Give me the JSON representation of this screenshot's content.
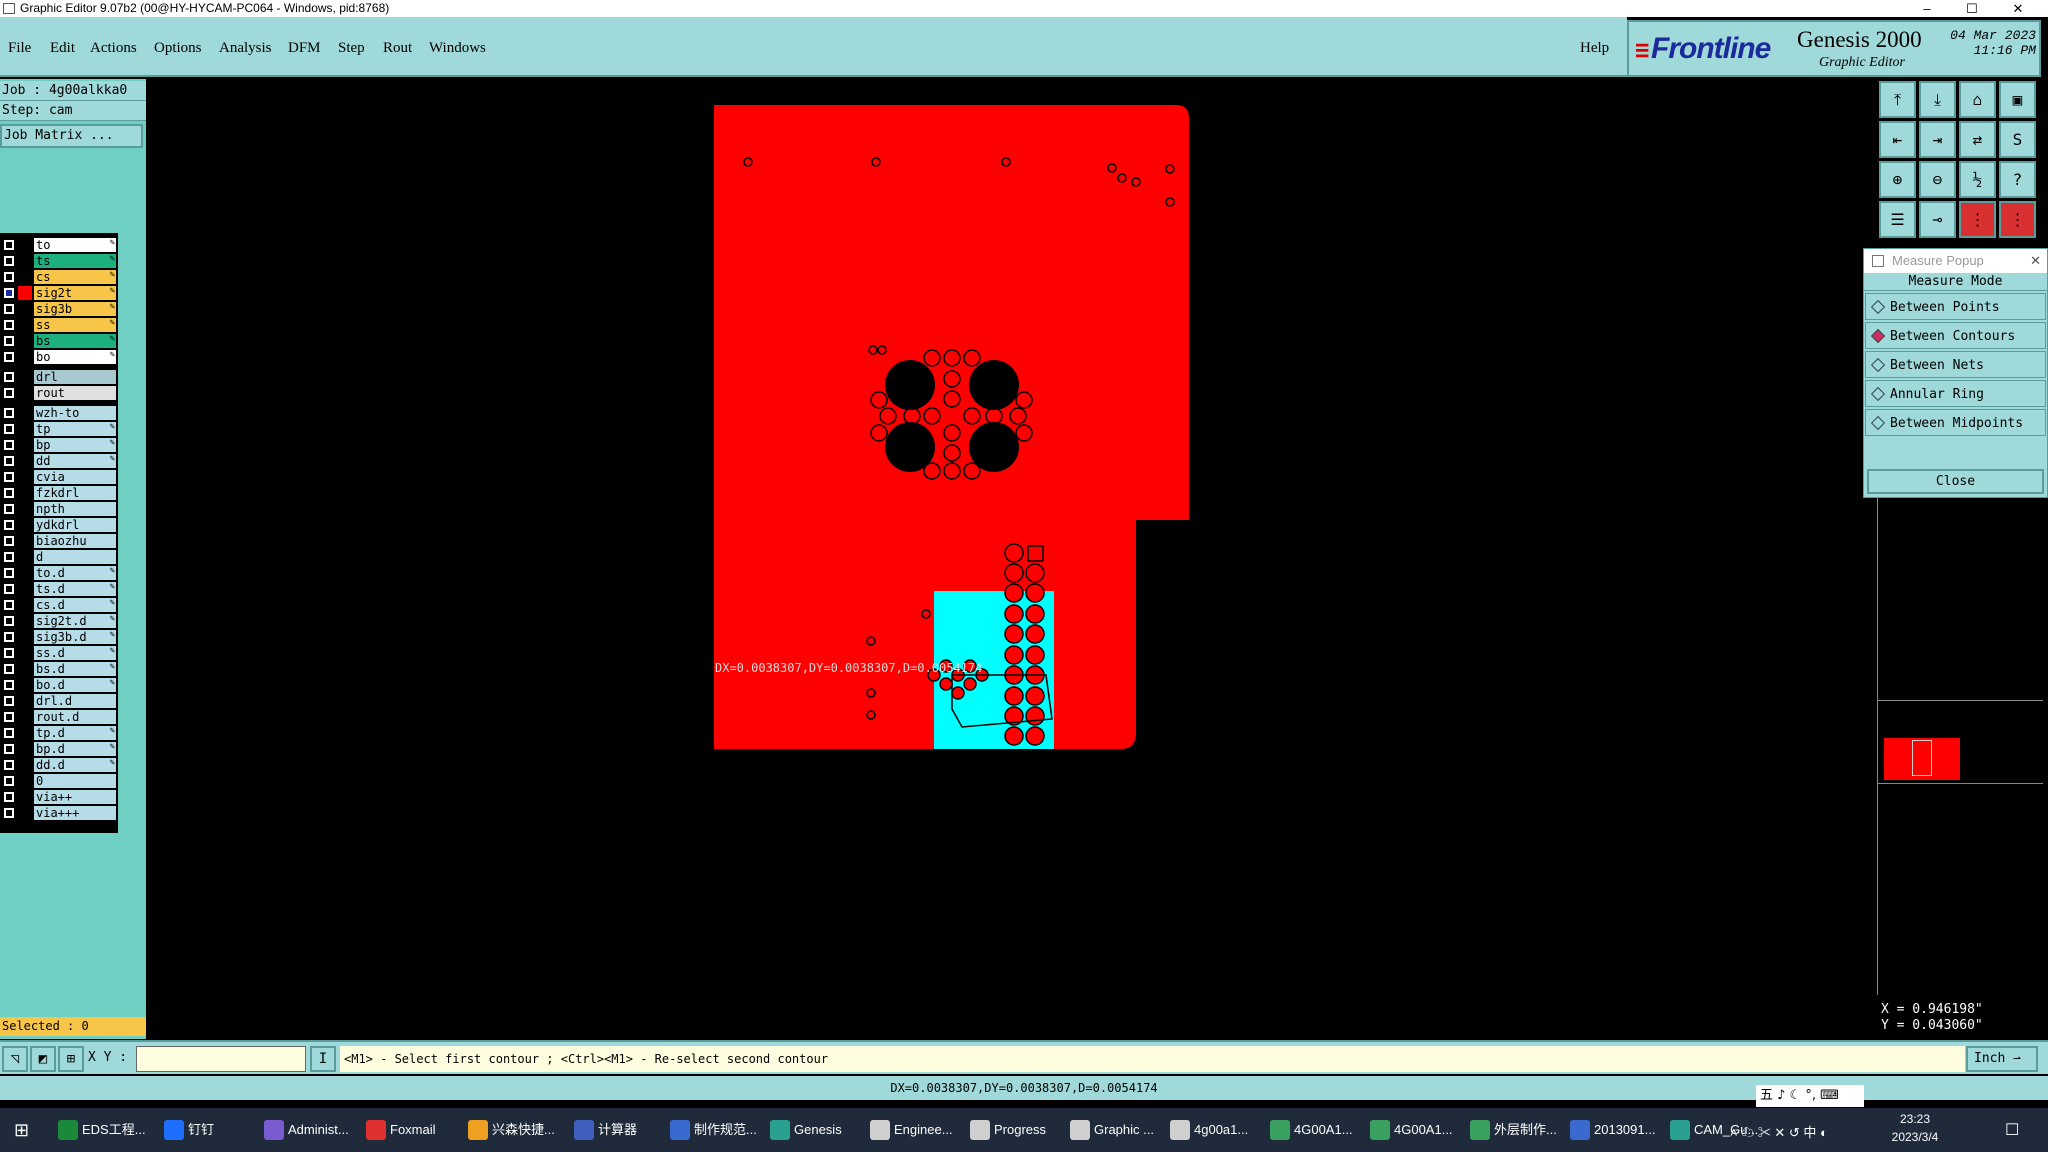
{
  "window": {
    "title": "Graphic Editor 9.07b2 (00@HY-HYCAM-PC064 - Windows, pid:8768)"
  },
  "menu": [
    "File",
    "Edit",
    "Actions",
    "Options",
    "Analysis",
    "DFM",
    "Step",
    "Rout",
    "Windows"
  ],
  "help_label": "Help",
  "brand": {
    "logo": "Frontline",
    "product": "Genesis 2000",
    "subtitle": "Graphic Editor",
    "date": "04 Mar 2023",
    "time": "11:16 PM"
  },
  "job": {
    "job_label": "Job : 4g00alkka0",
    "step_label": "Step: cam",
    "matrix_button": "Job Matrix ..."
  },
  "layers": [
    {
      "name": "to",
      "color": "#ffffff",
      "pen": true
    },
    {
      "name": "ts",
      "color": "#1db07f",
      "pen": true
    },
    {
      "name": "cs",
      "color": "#f7c648",
      "pen": true
    },
    {
      "name": "sig2t",
      "color": "#f7c648",
      "pen": true,
      "active": true
    },
    {
      "name": "sig3b",
      "color": "#f7c648",
      "pen": true
    },
    {
      "name": "ss",
      "color": "#f7c648",
      "pen": true
    },
    {
      "name": "bs",
      "color": "#1db07f",
      "pen": true
    },
    {
      "name": "bo",
      "color": "#ffffff",
      "pen": true
    },
    {
      "name": "drl",
      "color": "#a8c8d0",
      "pen": false
    },
    {
      "name": "rout",
      "color": "#e0e0e0",
      "pen": false
    },
    {
      "name": "wzh-to",
      "color": "#b6dce8",
      "pen": false
    },
    {
      "name": "tp",
      "color": "#b6dce8",
      "pen": true
    },
    {
      "name": "bp",
      "color": "#b6dce8",
      "pen": true
    },
    {
      "name": "dd",
      "color": "#b6dce8",
      "pen": true
    },
    {
      "name": "cvia",
      "color": "#b6dce8",
      "pen": false
    },
    {
      "name": "fzkdrl",
      "color": "#b6dce8",
      "pen": false
    },
    {
      "name": "npth",
      "color": "#b6dce8",
      "pen": false
    },
    {
      "name": "ydkdrl",
      "color": "#b6dce8",
      "pen": false
    },
    {
      "name": "biaozhu",
      "color": "#b6dce8",
      "pen": false
    },
    {
      "name": "d",
      "color": "#b6dce8",
      "pen": false
    },
    {
      "name": "to.d",
      "color": "#b6dce8",
      "pen": true
    },
    {
      "name": "ts.d",
      "color": "#b6dce8",
      "pen": true
    },
    {
      "name": "cs.d",
      "color": "#b6dce8",
      "pen": true
    },
    {
      "name": "sig2t.d",
      "color": "#b6dce8",
      "pen": true
    },
    {
      "name": "sig3b.d",
      "color": "#b6dce8",
      "pen": true
    },
    {
      "name": "ss.d",
      "color": "#b6dce8",
      "pen": true
    },
    {
      "name": "bs.d",
      "color": "#b6dce8",
      "pen": true
    },
    {
      "name": "bo.d",
      "color": "#b6dce8",
      "pen": true
    },
    {
      "name": "drl.d",
      "color": "#b6dce8",
      "pen": false
    },
    {
      "name": "rout.d",
      "color": "#b6dce8",
      "pen": false
    },
    {
      "name": "tp.d",
      "color": "#b6dce8",
      "pen": true
    },
    {
      "name": "bp.d",
      "color": "#b6dce8",
      "pen": true
    },
    {
      "name": "dd.d",
      "color": "#b6dce8",
      "pen": true
    },
    {
      "name": "0",
      "color": "#b6dce8",
      "pen": false
    },
    {
      "name": "via++",
      "color": "#b6dce8",
      "pen": false
    },
    {
      "name": "via+++",
      "color": "#b6dce8",
      "pen": false
    }
  ],
  "selected_label": "Selected : 0",
  "measure_popup": {
    "title": "Measure Popup",
    "mode_label": "Measure Mode",
    "options": [
      {
        "label": "Between Points",
        "on": false
      },
      {
        "label": "Between Contours",
        "on": true
      },
      {
        "label": "Between Nets",
        "on": false
      },
      {
        "label": "Annular Ring",
        "on": false
      },
      {
        "label": "Between Midpoints",
        "on": false
      }
    ],
    "close_label": "Close"
  },
  "canvas": {
    "measure_text": "DX=0.0038307,DY=0.0038307,D=0.0054174"
  },
  "coords": {
    "x": "X = 0.946198\"",
    "y": "Y = 0.043060\""
  },
  "cmd": {
    "xy_label": "X Y :",
    "message": "<M1> - Select first contour ; <Ctrl><M1> - Re-select second contour",
    "unit": "Inch"
  },
  "status": "DX=0.0038307,DY=0.0038307,D=0.0054174",
  "taskbar": {
    "items": [
      {
        "label": "EDS工程...",
        "color": "#1a8a3a"
      },
      {
        "label": "钉钉",
        "color": "#1e6fff"
      },
      {
        "label": "Administ...",
        "color": "#7a5bd0"
      },
      {
        "label": "Foxmail",
        "color": "#e03030"
      },
      {
        "label": "兴森快捷...",
        "color": "#f0a020"
      },
      {
        "label": "计算器",
        "color": "#4060c0"
      },
      {
        "label": "制作规范...",
        "color": "#3a6ad0"
      },
      {
        "label": "Genesis",
        "color": "#2aa090"
      },
      {
        "label": "Enginee...",
        "color": "#d0d0d0"
      },
      {
        "label": "Progress",
        "color": "#d0d0d0"
      },
      {
        "label": "Graphic ...",
        "color": "#d0d0d0"
      },
      {
        "label": "4g00a1...",
        "color": "#d0d0d0"
      },
      {
        "label": "4G00A1...",
        "color": "#3aa060"
      },
      {
        "label": "4G00A1...",
        "color": "#3aa060"
      },
      {
        "label": "外层制作...",
        "color": "#3aa060"
      },
      {
        "label": "2013091...",
        "color": "#3a6ad0"
      },
      {
        "label": "CAM_Gu...",
        "color": "#2aa090"
      }
    ],
    "clock_time": "23:23",
    "clock_date": "2023/3/4",
    "ime_chars": "五 ♪ ☾ °, ⌨"
  }
}
